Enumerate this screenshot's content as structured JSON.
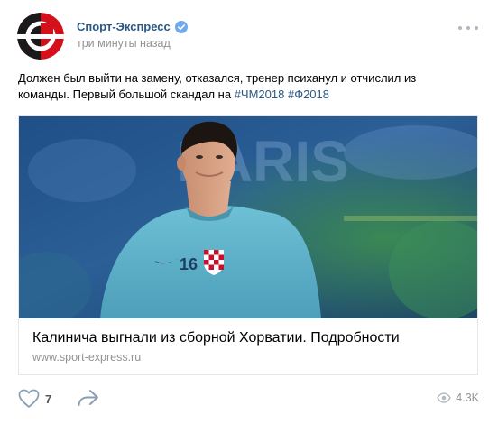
{
  "post": {
    "author": {
      "name": "Спорт-Экспресс",
      "verified": true,
      "time": "три минуты назад"
    },
    "text": {
      "main": "Должен был выйти на замену, отказался, тренер психанул и отчислил из команды. Первый большой скандал на ",
      "hashtags": [
        "#ЧМ2018",
        "#Ф2018"
      ]
    },
    "link": {
      "title": "Калинича выгнали из сборной Хорватии. Подробности",
      "domain": "www.sport-express.ru",
      "image": {
        "jersey_number": "16",
        "background_text": "PARIS"
      }
    },
    "footer": {
      "likes": "7",
      "views": "4.3K"
    }
  },
  "colors": {
    "link": "#2a5885",
    "muted": "#939393",
    "icon": "#aeb7c2",
    "jersey": "#5fb3cc",
    "logo_red": "#d4111b"
  }
}
